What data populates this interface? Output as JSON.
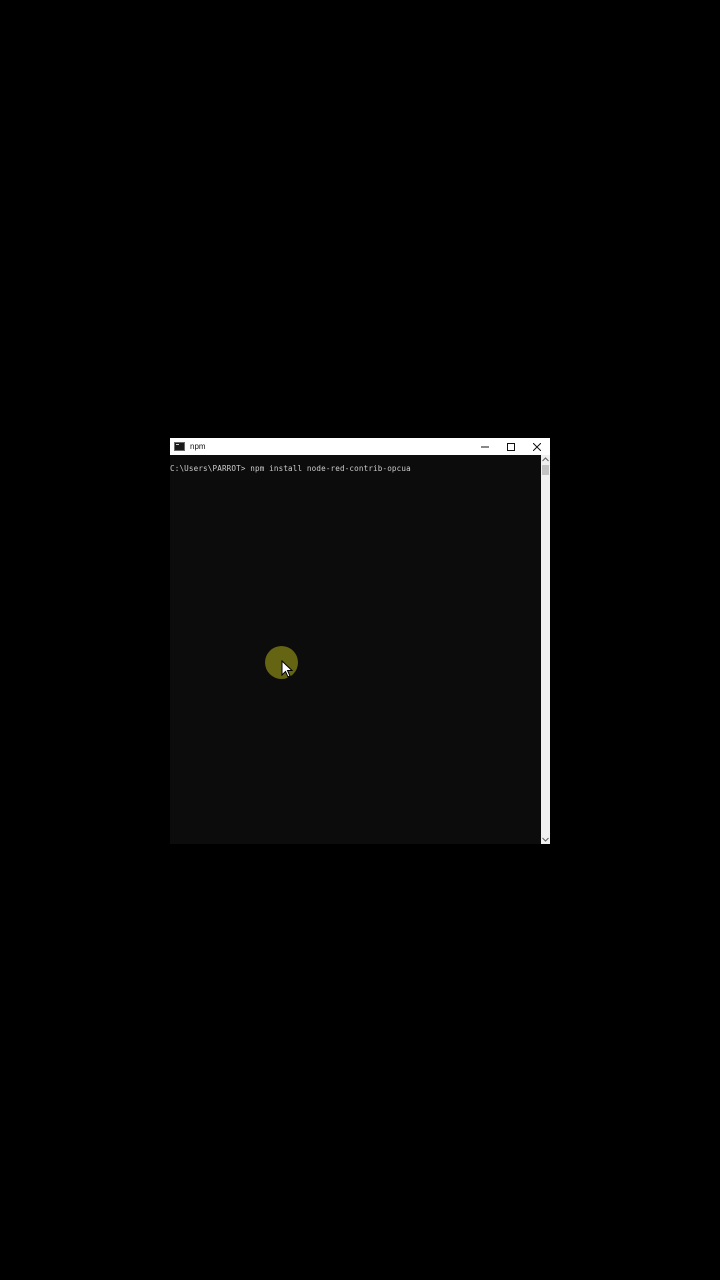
{
  "window": {
    "title": "npm",
    "controls": {
      "minimize_icon": "minimize-icon",
      "maximize_icon": "maximize-icon",
      "close_icon": "close-icon"
    }
  },
  "terminal": {
    "lines": [
      "C:\\Users\\PARROT> npm install node-red-contrib-opcua"
    ],
    "background": "#0c0c0c",
    "text_color": "#cccccc"
  },
  "colors": {
    "desktop": "#000000",
    "titlebar": "#ffffff",
    "cursor_highlight": "#828214"
  }
}
